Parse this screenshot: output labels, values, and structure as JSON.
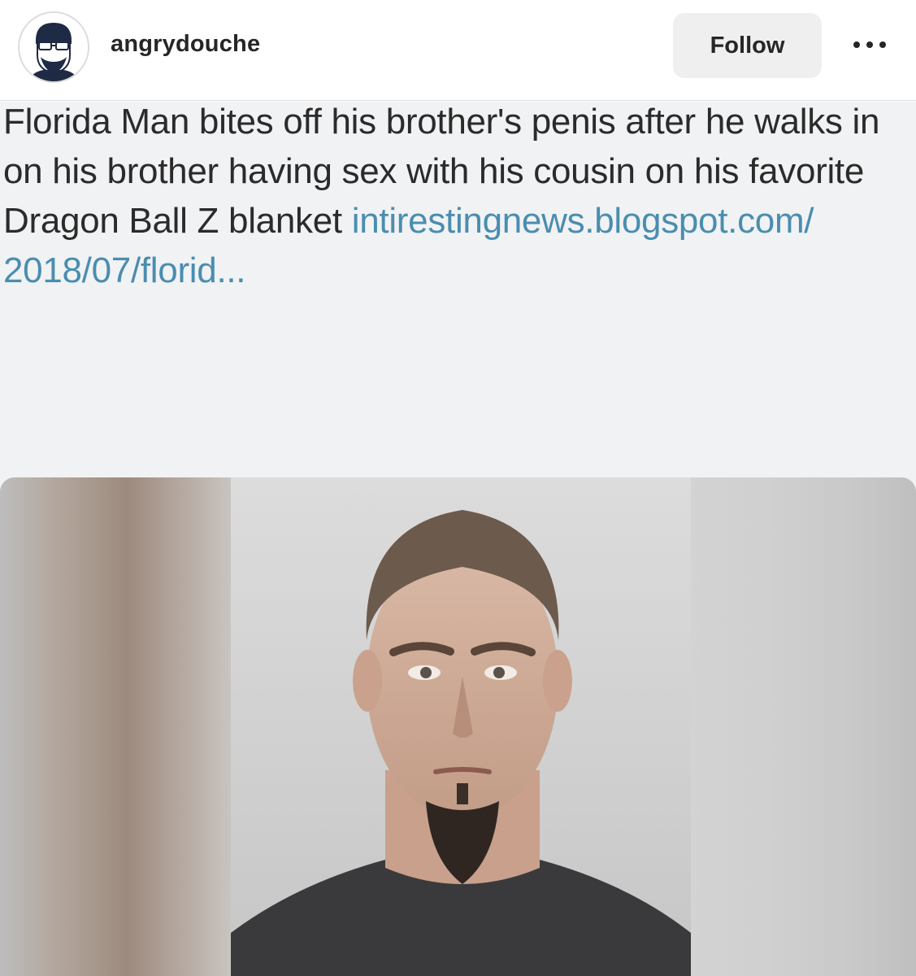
{
  "header": {
    "username": "angrydouche",
    "follow_label": "Follow",
    "avatar_icon": "bearded-man-avatar-icon",
    "more_icon": "more-options-icon"
  },
  "post": {
    "tweet_text": "Florida Man bites off his brother's penis after he walks in on his brother having sex with his cousin on his favorite Dragon Ball Z blanket",
    "link_line1": "intirestingnews.blogspot.com/",
    "link_line2": "2018/07/florid...",
    "photo": "mugshot-photo"
  },
  "colors": {
    "follow_bg": "#efefef",
    "link": "#4a8db0",
    "text": "#2b2b2b"
  }
}
